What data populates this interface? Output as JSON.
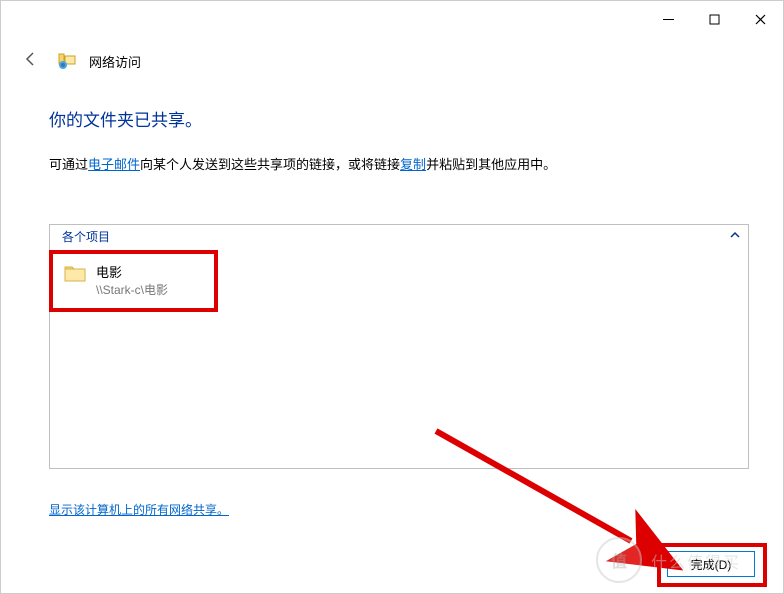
{
  "window": {
    "title": "网络访问"
  },
  "main": {
    "heading": "你的文件夹已共享。",
    "instruction_pre": "可通过",
    "instruction_link1": "电子邮件",
    "instruction_mid": "向某个人发送到这些共享项的链接，或将链接",
    "instruction_link2": "复制",
    "instruction_post": "并粘贴到其他应用中。"
  },
  "panel": {
    "header": "各个项目",
    "items": [
      {
        "name": "电影",
        "path": "\\\\Stark-c\\电影"
      }
    ]
  },
  "bottom_link": "显示该计算机上的所有网络共享。",
  "footer": {
    "done": "完成(D)"
  }
}
